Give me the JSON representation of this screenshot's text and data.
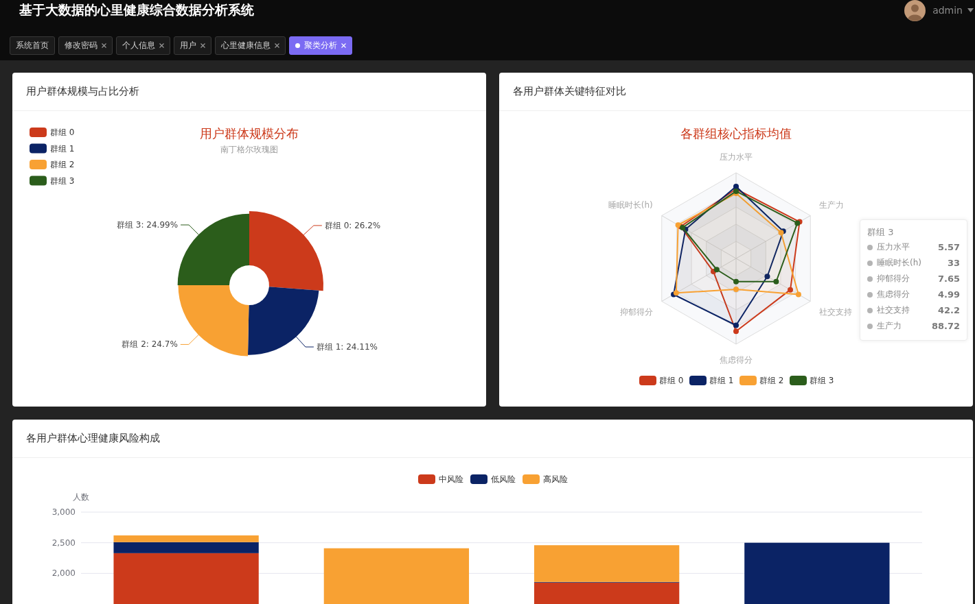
{
  "header": {
    "title": "基于大数据的心里健康综合数据分析系统",
    "user": {
      "name": "admin"
    }
  },
  "tabs": [
    {
      "label": "系统首页",
      "closable": false,
      "selected": false
    },
    {
      "label": "修改密码",
      "closable": true,
      "selected": false
    },
    {
      "label": "个人信息",
      "closable": true,
      "selected": false
    },
    {
      "label": "用户",
      "closable": true,
      "selected": false
    },
    {
      "label": "心里健康信息",
      "closable": true,
      "selected": false
    },
    {
      "label": "聚类分析",
      "closable": true,
      "selected": true
    }
  ],
  "group_size_panel": {
    "title": "用户群体规模与占比分析",
    "subtitle": "南丁格尔玫瑰图",
    "chart_data": {
      "type": "donut",
      "title": "用户群体规模分布",
      "legend": "left",
      "categories": [
        "群组 0",
        "群组 1",
        "群组 2",
        "群组 3"
      ],
      "values": [
        26.2,
        24.11,
        24.7,
        24.99
      ],
      "colors": [
        "#cc3a1b",
        "#0b2365",
        "#f8a133",
        "#2b5d1b"
      ],
      "value_labels": [
        "群组 0: 26.2%",
        "群组 1: 24.11%",
        "群组 2: 24.7%",
        "群组 3: 24.99%"
      ]
    }
  },
  "feature_panel": {
    "title": "各用户群体关键特征对比",
    "chart_title": "各群组核心指标均值",
    "axes": [
      "压力水平",
      "睡眠时长(h)",
      "抑郁得分",
      "焦虑得分",
      "社交支持",
      "生产力"
    ],
    "legend": [
      {
        "label": "群组 0",
        "color": "#cc3a1b"
      },
      {
        "label": "群组 1",
        "color": "#0b2365"
      },
      {
        "label": "群组 2",
        "color": "#f8a133"
      },
      {
        "label": "群组 3",
        "color": "#2b5d1b"
      }
    ],
    "tooltip": {
      "title": "群组 3",
      "rows": [
        {
          "label": "压力水平",
          "value": "5.57"
        },
        {
          "label": "睡眠时长(h)",
          "value": "33"
        },
        {
          "label": "抑郁得分",
          "value": "7.65"
        },
        {
          "label": "焦虑得分",
          "value": "4.99"
        },
        {
          "label": "社交支持",
          "value": "42.2"
        },
        {
          "label": "生产力",
          "value": "88.72"
        }
      ]
    }
  },
  "risk_panel": {
    "title": "各用户群体心理健康风险构成",
    "chart_data": {
      "type": "bar",
      "stacked": true,
      "legend": "top",
      "ylabel": "人数",
      "ylim": [
        0,
        3000
      ],
      "yticks": [
        {
          "value": 2000,
          "label": "2,000"
        },
        {
          "value": 2500,
          "label": "2,500"
        },
        {
          "value": 3000,
          "label": "3,000"
        }
      ],
      "series": [
        {
          "name": "中风险",
          "color": "#cc3a1b",
          "values": [
            2330,
            null,
            1850,
            null
          ]
        },
        {
          "name": "低风险",
          "color": "#0b2365",
          "values": [
            180,
            null,
            10,
            2500
          ]
        },
        {
          "name": "高风险",
          "color": "#f8a133",
          "values": [
            110,
            2410,
            600,
            null
          ]
        }
      ]
    }
  }
}
